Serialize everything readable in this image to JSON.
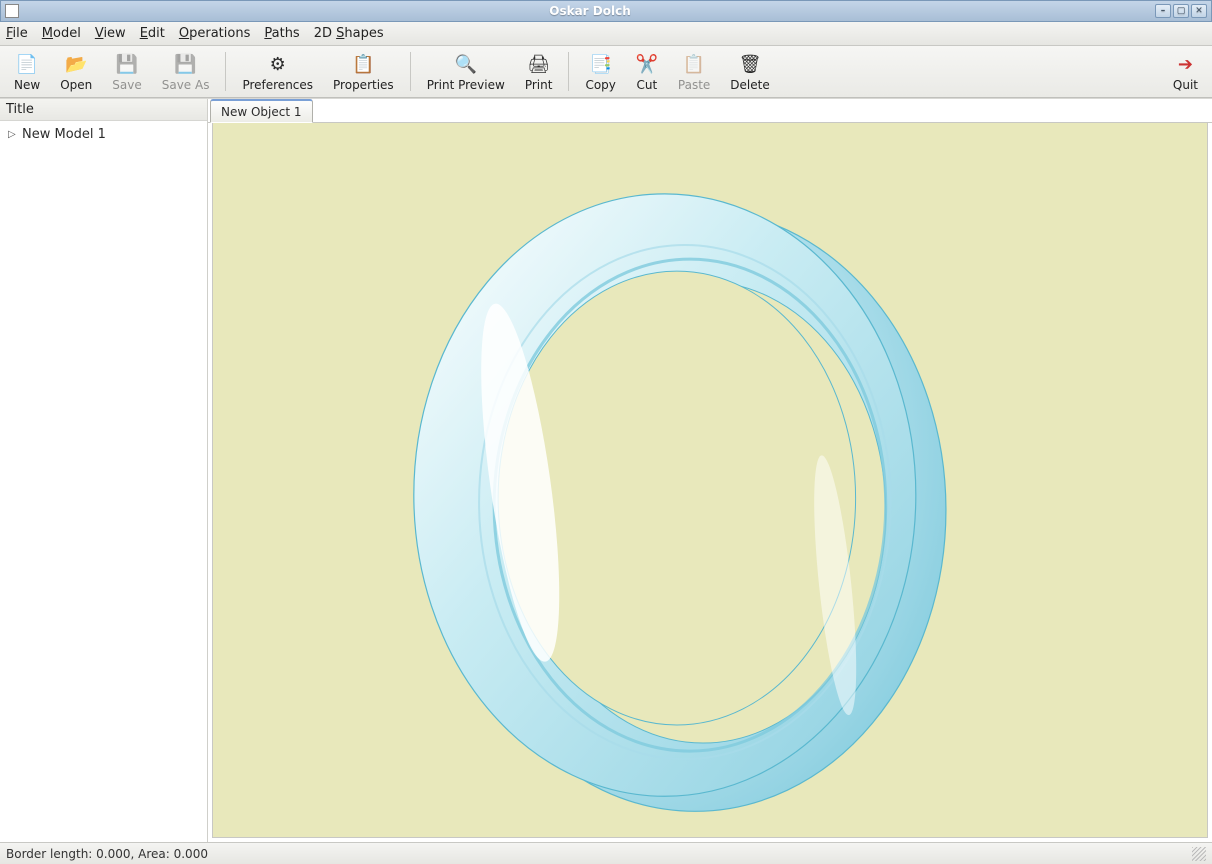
{
  "window": {
    "title": "Oskar Dolch"
  },
  "menubar": {
    "file": "File",
    "model": "Model",
    "view": "View",
    "edit": "Edit",
    "operations": "Operations",
    "paths": "Paths",
    "shapes2d": "2D Shapes"
  },
  "toolbar": {
    "new": "New",
    "open": "Open",
    "save": "Save",
    "save_as": "Save As",
    "preferences": "Preferences",
    "properties": "Properties",
    "print_preview": "Print Preview",
    "print": "Print",
    "copy": "Copy",
    "cut": "Cut",
    "paste": "Paste",
    "delete": "Delete",
    "quit": "Quit"
  },
  "sidebar": {
    "header": "Title",
    "items": [
      {
        "label": "New Model 1"
      }
    ]
  },
  "tabs": [
    {
      "label": "New Object 1"
    }
  ],
  "statusbar": {
    "text": "Border length: 0.000, Area: 0.000"
  },
  "colors": {
    "canvas_bg": "#e8e8bb",
    "ring_fill": "#bde6ef",
    "ring_stroke": "#5ab8cf",
    "ring_highlight": "#ffffff"
  }
}
